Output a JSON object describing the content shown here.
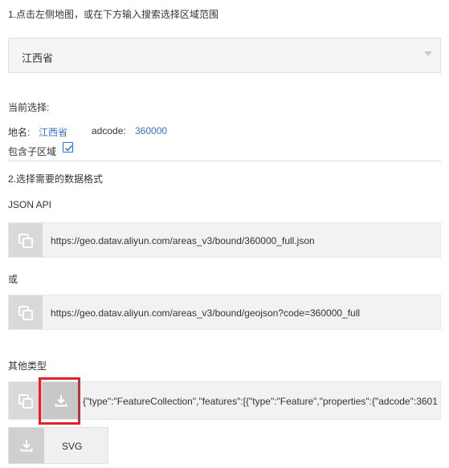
{
  "step1": {
    "instruction": "1.点击左侧地图，或在下方输入搜索选择区域范围"
  },
  "region_select": {
    "selected": "江西省"
  },
  "current": {
    "heading": "当前选择:",
    "place_label": "地名:",
    "place_value": "江西省",
    "adcode_label": "adcode:",
    "adcode_value": "360000",
    "include_children_label": "包含子区域",
    "include_children_checked": true
  },
  "step2": {
    "instruction": "2.选择需要的数据格式"
  },
  "json_api": {
    "heading": "JSON API",
    "url_full": "https://geo.datav.aliyun.com/areas_v3/bound/360000_full.json",
    "or_label": "或",
    "url_geojson": "https://geo.datav.aliyun.com/areas_v3/bound/geojson?code=360000_full"
  },
  "other": {
    "heading": "其他类型",
    "geojson_preview": "{\"type\":\"FeatureCollection\",\"features\":[{\"type\":\"Feature\",\"properties\":{\"adcode\":3601",
    "svg_label": "SVG"
  },
  "colors": {
    "link": "#3b6fd1",
    "highlight": "#e0242b",
    "icon_bg": "#d9d9d9"
  },
  "icons": {
    "copy": "copy-icon",
    "download": "download-icon",
    "dropdown": "chevron-down-icon",
    "check": "check-icon"
  }
}
